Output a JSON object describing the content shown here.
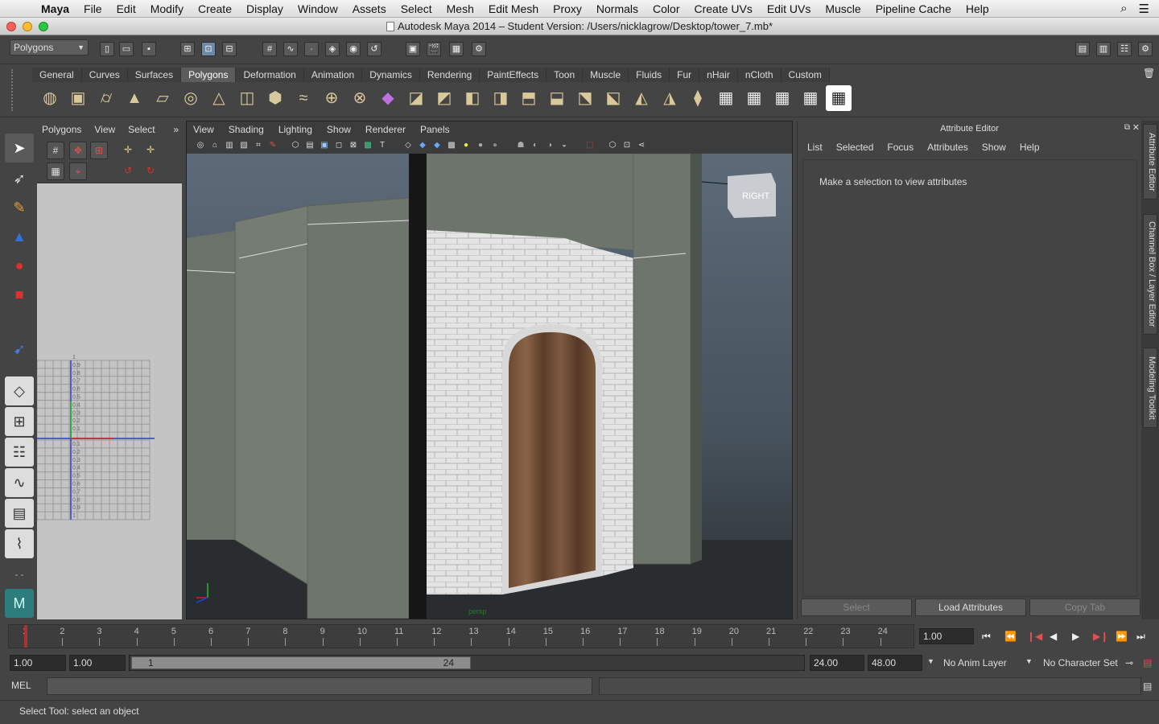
{
  "menubar": {
    "app_name": "Maya",
    "items": [
      "File",
      "Edit",
      "Modify",
      "Create",
      "Display",
      "Window",
      "Assets",
      "Select",
      "Mesh",
      "Edit Mesh",
      "Proxy",
      "Normals",
      "Color",
      "Create UVs",
      "Edit UVs",
      "Muscle",
      "Pipeline Cache",
      "Help"
    ]
  },
  "window": {
    "title": "Autodesk Maya 2014 – Student Version: /Users/nicklagrow/Desktop/tower_7.mb*",
    "light_colors": [
      "#ff5f57",
      "#febc2e",
      "#28c840"
    ]
  },
  "statusline": {
    "mode": "Polygons"
  },
  "shelf": {
    "tabs": [
      "General",
      "Curves",
      "Surfaces",
      "Polygons",
      "Deformation",
      "Animation",
      "Dynamics",
      "Rendering",
      "PaintEffects",
      "Toon",
      "Muscle",
      "Fluids",
      "Fur",
      "nHair",
      "nCloth",
      "Custom"
    ],
    "active_tab": "Polygons"
  },
  "leftpanel": {
    "menu": [
      "Polygons",
      "View",
      "Select"
    ],
    "more": "»",
    "uv_labels_top": [
      "1",
      "0.9",
      "0.8",
      "0.7",
      "0.6",
      "0.5",
      "0.4",
      "0.3",
      "0.2",
      "0.1"
    ],
    "uv_labels_bottom": [
      "0.1",
      "0.2",
      "0.3",
      "0.4",
      "0.5",
      "0.6",
      "0.7",
      "0.8",
      "0.9",
      "1"
    ]
  },
  "viewport": {
    "menu": [
      "View",
      "Shading",
      "Lighting",
      "Show",
      "Renderer",
      "Panels"
    ],
    "camera_label": "persp",
    "viewcube_label": "RIGHT"
  },
  "attribute_editor": {
    "title": "Attribute Editor",
    "menu": [
      "List",
      "Selected",
      "Focus",
      "Attributes",
      "Show",
      "Help"
    ],
    "message": "Make a selection to view attributes",
    "buttons": [
      "Select",
      "Load Attributes",
      "Copy Tab"
    ]
  },
  "side_tabs": [
    "Attribute Editor",
    "Channel Box / Layer Editor",
    "Modeling Toolkit"
  ],
  "timeslider": {
    "ticks": [
      "1",
      "2",
      "3",
      "4",
      "5",
      "6",
      "7",
      "8",
      "9",
      "10",
      "11",
      "12",
      "13",
      "14",
      "15",
      "16",
      "17",
      "18",
      "19",
      "20",
      "21",
      "22",
      "23",
      "24"
    ],
    "current_frame": "1.00"
  },
  "range": {
    "start_time": "1.00",
    "playback_start": "1.00",
    "range_start_label": "1",
    "range_end_label": "24",
    "playback_end": "24.00",
    "end_time": "48.00",
    "anim_layer": "No Anim Layer",
    "character_set": "No Character Set"
  },
  "cmdline": {
    "language": "MEL"
  },
  "helpline": {
    "text": "Select Tool: select an object"
  },
  "colors": {
    "ui_bg": "#444444",
    "viewport_top": "#5d6a78",
    "active_tab": "#5c5c5c"
  }
}
